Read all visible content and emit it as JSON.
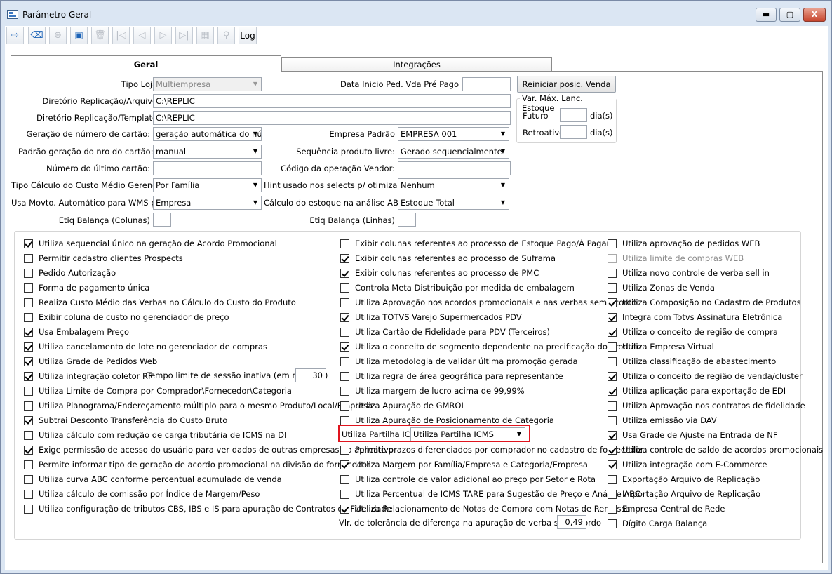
{
  "window": {
    "title": "Parâmetro Geral",
    "min_label": "▬",
    "max_label": "▢",
    "close_label": "X"
  },
  "toolbar": {
    "buttons": [
      {
        "name": "exit-icon",
        "glyph": "⇨"
      },
      {
        "name": "eraser-icon",
        "glyph": "⌫"
      },
      {
        "name": "add-icon",
        "glyph": "⊕"
      },
      {
        "name": "save-icon",
        "glyph": "▣"
      },
      {
        "name": "delete-icon",
        "glyph": "🗑"
      },
      {
        "name": "first-record-icon",
        "glyph": "|◁"
      },
      {
        "name": "previous-record-icon",
        "glyph": "◁"
      },
      {
        "name": "next-record-icon",
        "glyph": "▷"
      },
      {
        "name": "last-record-icon",
        "glyph": "▷|"
      },
      {
        "name": "grid-icon",
        "glyph": "▦"
      },
      {
        "name": "search-icon",
        "glyph": "⚲"
      }
    ],
    "log_label": "Log"
  },
  "tabs": [
    {
      "label": "Geral"
    },
    {
      "label": "Integrações"
    }
  ],
  "form": {
    "tipo_loja": {
      "label": "Tipo Loja:",
      "value": "Multiempresa"
    },
    "data_inicio": {
      "label": "Data Inicio Ped. Vda Pré Pago",
      "value": ""
    },
    "reiniciar_label": "Reiniciar posic. Venda",
    "dir_arquivo": {
      "label": "Diretório Replicação/Arquivo:",
      "value": "C:\\REPLIC"
    },
    "dir_template": {
      "label": "Diretório Replicação/Template:",
      "value": "C:\\REPLIC"
    },
    "var_max": {
      "title": "Var. Máx. Lanc. Estoque",
      "futuro": "Futuro",
      "retroativo": "Retroativo",
      "unit": "dia(s)"
    },
    "geracao_cartao": {
      "label": "Geração de número de cartão:",
      "value": "geração automática do núm"
    },
    "empresa_padrao": {
      "label": "Empresa Padrão",
      "value": "EMPRESA 001"
    },
    "padrao_geracao": {
      "label": "Padrão geração do nro do cartão:",
      "value": "manual"
    },
    "sequencia_produto": {
      "label": "Sequência produto livre:",
      "value": "Gerado sequencialmente"
    },
    "numero_ultimo_cartao": {
      "label": "Número do último cartão:",
      "value": ""
    },
    "codigo_operacao": {
      "label": "Código da operação Vendor:",
      "value": ""
    },
    "tipo_calculo": {
      "label": "Tipo Cálculo do Custo Médio Gerencial:",
      "value": "Por Família"
    },
    "hint_selects": {
      "label": "Hint usado nos selects p/ otimização:",
      "value": "Nenhum"
    },
    "usa_movto": {
      "label": "Usa Movto. Automático para WMS por",
      "value": "Empresa"
    },
    "calculo_estoque": {
      "label": "Cálculo do estoque na análise ABC:",
      "value": "Estoque Total"
    },
    "etiq_colunas": {
      "label": "Etiq Balança (Colunas)",
      "value": ""
    },
    "etiq_linhas": {
      "label": "Etiq Balança (Linhas)",
      "value": ""
    }
  },
  "options": {
    "col1": [
      {
        "label": "Utiliza sequencial único na geração de Acordo Promocional",
        "checked": true
      },
      {
        "label": "Permitir cadastro clientes Prospects",
        "checked": false
      },
      {
        "label": "Pedido Autorização",
        "checked": false
      },
      {
        "label": "Forma de pagamento única",
        "checked": false
      },
      {
        "label": "Realiza Custo Médio das Verbas no Cálculo do Custo do Produto",
        "checked": false
      },
      {
        "label": "Exibir coluna de custo no gerenciador de preço",
        "checked": false
      },
      {
        "label": "Usa Embalagem Preço",
        "checked": true
      },
      {
        "label": "Utiliza cancelamento de lote no gerenciador de compras",
        "checked": true
      },
      {
        "label": "Utiliza Grade de Pedidos Web",
        "checked": true
      },
      {
        "label": "Utiliza integração coletor RF",
        "checked": true
      },
      {
        "label": "Utiliza Limite de Compra por Comprador\\Fornecedor\\Categoria",
        "checked": false
      },
      {
        "label": "Utiliza Planograma/Endereçamento múltiplo para o mesmo Produto/Local/Empresa",
        "checked": false
      },
      {
        "label": "Subtrai Desconto Transferência do Custo Bruto",
        "checked": true
      },
      {
        "label": "Utiliza cálculo com redução de carga tributária de ICMS na DI",
        "checked": false
      },
      {
        "label": "Exige permissão de acesso do usuário para ver dados de outras empresas no aplicativo",
        "checked": true
      },
      {
        "label": "Permite informar tipo de geração de acordo promocional na divisão do fornecedor",
        "checked": false
      },
      {
        "label": "Utiliza curva ABC conforme percentual acumulado de venda",
        "checked": false
      },
      {
        "label": "Utiliza cálculo de comissão por Índice de Margem/Peso",
        "checked": false
      },
      {
        "label": "Utiliza configuração de tributos CBS, IBS e IS para apuração de Contratos de Fidelidade",
        "checked": false
      }
    ],
    "col2": [
      {
        "label": "Exibir colunas referentes ao processo de Estoque Pago/À Pagar",
        "checked": false
      },
      {
        "label": "Exibir colunas referentes ao processo de Suframa",
        "checked": true
      },
      {
        "label": "Exibir colunas referentes ao processo de PMC",
        "checked": true
      },
      {
        "label": "Controla Meta Distribuição por medida de embalagem",
        "checked": false
      },
      {
        "label": "Utiliza Aprovação nos acordos promocionais e nas verbas sem acordo",
        "checked": false
      },
      {
        "label": "Utiliza TOTVS Varejo Supermercados PDV",
        "checked": true
      },
      {
        "label": "Utiliza Cartão de Fidelidade para PDV (Terceiros)",
        "checked": false
      },
      {
        "label": "Utiliza o conceito de segmento dependente na precificação do produto",
        "checked": true
      },
      {
        "label": "Utiliza metodologia de validar última promoção gerada",
        "checked": false
      },
      {
        "label": "Utiliza regra de área geográfica para representante",
        "checked": false
      },
      {
        "label": "Utiliza margem de lucro acima de 99,99%",
        "checked": false
      },
      {
        "label": "Utiliza Apuração de GMROI",
        "checked": false
      },
      {
        "label": "Utiliza Apuração de Posicionamento de Categoria",
        "checked": false
      },
      {
        "label": "Permite prazos diferenciados por comprador no cadastro de fornecedor",
        "checked": false
      },
      {
        "label": "Utiliza Margem por Família/Empresa e Categoria/Empresa",
        "checked": true
      },
      {
        "label": "Utiliza controle de valor adicional ao preço por Setor e Rota",
        "checked": false
      },
      {
        "label": "Utiliza Percentual de ICMS TARE para Sugestão de Preço e Análise ABC",
        "checked": false
      },
      {
        "label": "Utiliza Relacionamento de Notas de Compra com Notas de Remessa",
        "checked": true
      }
    ],
    "col3": [
      {
        "label": "Utiliza aprovação de pedidos WEB",
        "checked": false,
        "disabled": false
      },
      {
        "label": "Utiliza limite de compras WEB",
        "checked": false,
        "disabled": true
      },
      {
        "label": "Utiliza novo controle de verba sell in",
        "checked": false,
        "disabled": false
      },
      {
        "label": "Utiliza Zonas de Venda",
        "checked": false,
        "disabled": false
      },
      {
        "label": "Utiliza Composição no Cadastro de Produtos",
        "checked": true,
        "disabled": false
      },
      {
        "label": "Integra com Totvs Assinatura Eletrônica",
        "checked": true,
        "disabled": false
      },
      {
        "label": "Utiliza o conceito de região de compra",
        "checked": true,
        "disabled": false
      },
      {
        "label": "Utiliza Empresa Virtual",
        "checked": false,
        "disabled": false
      },
      {
        "label": "Utiliza classificação de abastecimento",
        "checked": false,
        "disabled": false
      },
      {
        "label": "Utiliza o conceito de região de venda/cluster",
        "checked": true,
        "disabled": false
      },
      {
        "label": "Utiliza aplicação para exportação de EDI",
        "checked": true,
        "disabled": false
      },
      {
        "label": "Utiliza Aprovação nos contratos de fidelidade",
        "checked": false,
        "disabled": false
      },
      {
        "label": "Utiliza emissão via DAV",
        "checked": false,
        "disabled": false
      },
      {
        "label": "Usa Grade de Ajuste na Entrada de NF",
        "checked": true,
        "disabled": false
      },
      {
        "label": "Utiliza controle de saldo de acordos promocionais",
        "checked": true,
        "disabled": false
      },
      {
        "label": "Utiliza integração com E-Commerce",
        "checked": true,
        "disabled": false
      },
      {
        "label": "Exportação Arquivo de Replicação",
        "checked": false,
        "disabled": false
      },
      {
        "label": "Importação Arquivo de Replicação",
        "checked": false,
        "disabled": false
      },
      {
        "label": "Empresa Central de Rede",
        "checked": false,
        "disabled": false
      },
      {
        "label": "Dígito Carga Balança",
        "checked": false,
        "disabled": false
      }
    ],
    "tempo_limite": {
      "label": "Tempo limite de sessão inativa (em minutos)",
      "value": "30"
    },
    "partilha": {
      "label": "Utiliza Partilha ICMS",
      "value": "Utiliza Partilha ICMS"
    },
    "tolerancia": {
      "label": "Vlr. de tolerância de diferença na apuração de verba sem acordo",
      "value": "0,49"
    }
  },
  "colors": {
    "highlight": "#e0141e",
    "accent": "#1c63b7"
  }
}
